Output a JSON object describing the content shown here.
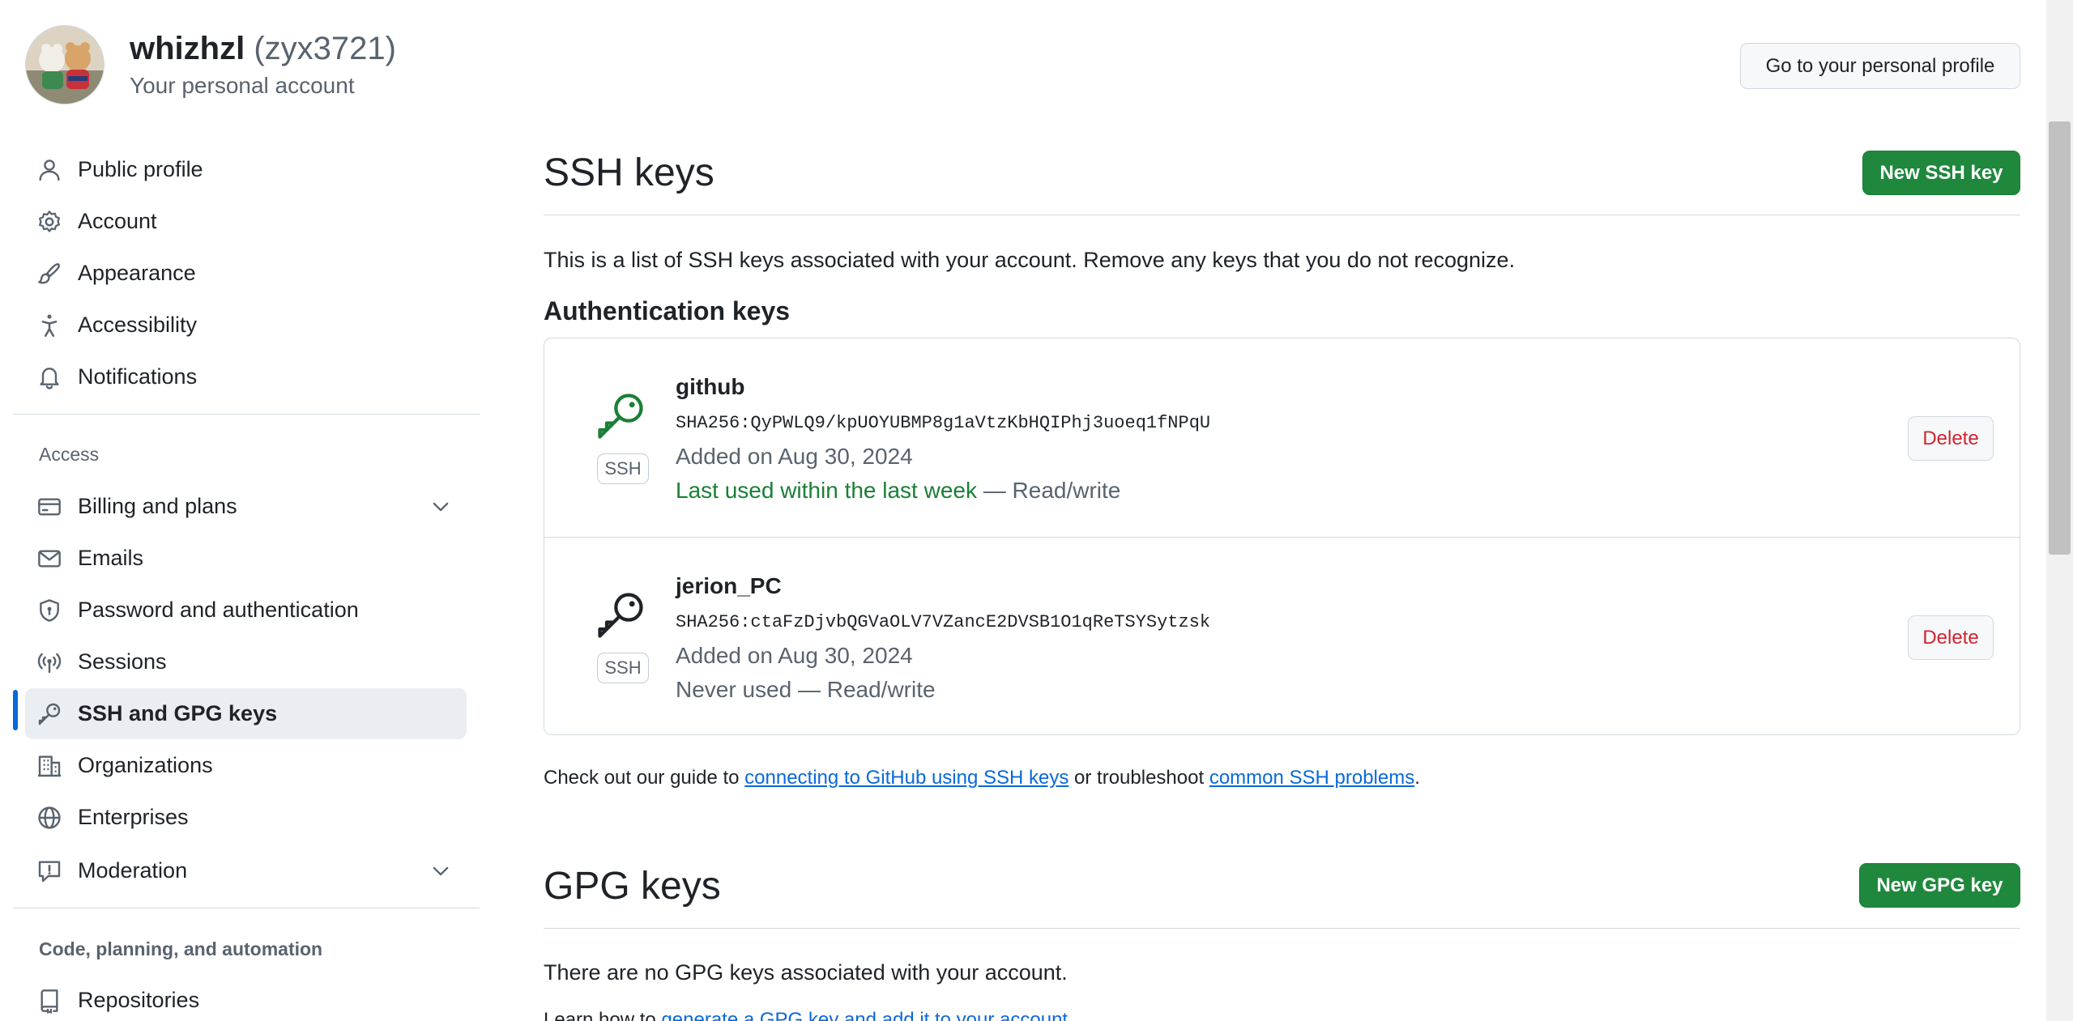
{
  "header": {
    "display_name": "whizhzl",
    "login": "(zyx3721)",
    "subtitle": "Your personal account",
    "profile_button": "Go to your personal profile"
  },
  "sidebar": {
    "items_top": [
      {
        "label": "Public profile",
        "icon": "person-icon"
      },
      {
        "label": "Account",
        "icon": "gear-icon"
      },
      {
        "label": "Appearance",
        "icon": "paintbrush-icon"
      },
      {
        "label": "Accessibility",
        "icon": "accessibility-icon"
      },
      {
        "label": "Notifications",
        "icon": "bell-icon"
      }
    ],
    "access_heading": "Access",
    "items_access": [
      {
        "label": "Billing and plans",
        "icon": "credit-card-icon"
      },
      {
        "label": "Emails",
        "icon": "mail-icon"
      },
      {
        "label": "Password and authentication",
        "icon": "shield-lock-icon"
      },
      {
        "label": "Sessions",
        "icon": "broadcast-icon"
      },
      {
        "label": "SSH and GPG keys",
        "icon": "key-icon"
      },
      {
        "label": "Organizations",
        "icon": "organization-icon"
      },
      {
        "label": "Enterprises",
        "icon": "globe-icon"
      },
      {
        "label": "Moderation",
        "icon": "report-icon"
      }
    ],
    "code_heading": "Code, planning, and automation",
    "items_code": [
      {
        "label": "Repositories",
        "icon": "repo-icon"
      }
    ]
  },
  "ssh": {
    "title": "SSH keys",
    "new_button": "New SSH key",
    "description": "This is a list of SSH keys associated with your account. Remove any keys that you do not recognize.",
    "auth_heading": "Authentication keys",
    "keys": [
      {
        "title": "github",
        "badge": "SSH",
        "fingerprint": "SHA256:QyPWLQ9/kpUOYUBMP8g1aVtzKbHQIPhj3uoeq1fNPqU",
        "added": "Added on Aug 30, 2024",
        "last_used": "Last used within the last week",
        "access": " — Read/write",
        "delete": "Delete",
        "icon_color": "#1a7f37"
      },
      {
        "title": "jerion_PC",
        "badge": "SSH",
        "fingerprint": "SHA256:ctaFzDjvbQGVaOLV7VZancE2DVSB1O1qReTSYSytzsk",
        "added": "Added on Aug 30, 2024",
        "last_used": "Never used",
        "access": " — Read/write",
        "delete": "Delete",
        "icon_color": "#1f2328"
      }
    ],
    "guide_prefix": "Check out our guide to ",
    "guide_link1": "connecting to GitHub using SSH keys",
    "guide_middle": " or troubleshoot ",
    "guide_link2": "common SSH problems",
    "guide_suffix": "."
  },
  "gpg": {
    "title": "GPG keys",
    "new_button": "New GPG key",
    "empty": "There are no GPG keys associated with your account.",
    "learn_prefix": "Learn how to ",
    "learn_link": "generate a GPG key and add it to your account",
    "learn_suffix": "."
  },
  "colors": {
    "primary_green": "#1f883d",
    "danger_red": "#d1242f",
    "link_blue": "#0969da",
    "active_indicator": "#0969da"
  }
}
